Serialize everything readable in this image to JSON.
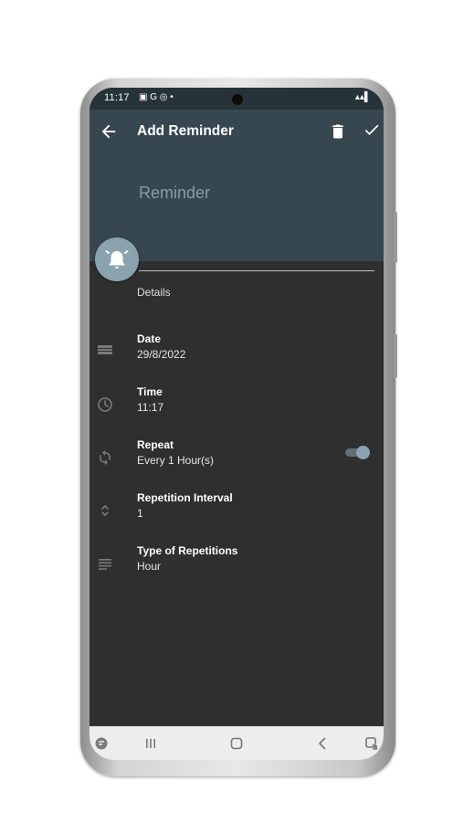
{
  "status_bar": {
    "time": "11:17",
    "icons": "▣ G ◎  •",
    "signal": "▴▴▌"
  },
  "header": {
    "title": "Add Reminder",
    "reminder_placeholder": "Reminder",
    "back_icon": "arrow-back-icon",
    "delete_icon": "delete-icon",
    "save_icon": "check-icon"
  },
  "details": {
    "section_label": "Details",
    "rows": [
      {
        "label": "Date",
        "value": "29/8/2022",
        "icon": "calendar-icon"
      },
      {
        "label": "Time",
        "value": "11:17",
        "icon": "clock-icon"
      },
      {
        "label": "Repeat",
        "value": "Every 1 Hour(s)",
        "icon": "repeat-icon",
        "toggle_on": true
      },
      {
        "label": "Repetition Interval",
        "value": "1",
        "icon": "unfold-icon"
      },
      {
        "label": "Type of Repetitions",
        "value": "Hour",
        "icon": "subject-icon"
      }
    ]
  },
  "colors": {
    "header": "#37474f",
    "statusbar": "#263339",
    "background": "#2f2f2f",
    "accent": "#8aa3ae"
  }
}
